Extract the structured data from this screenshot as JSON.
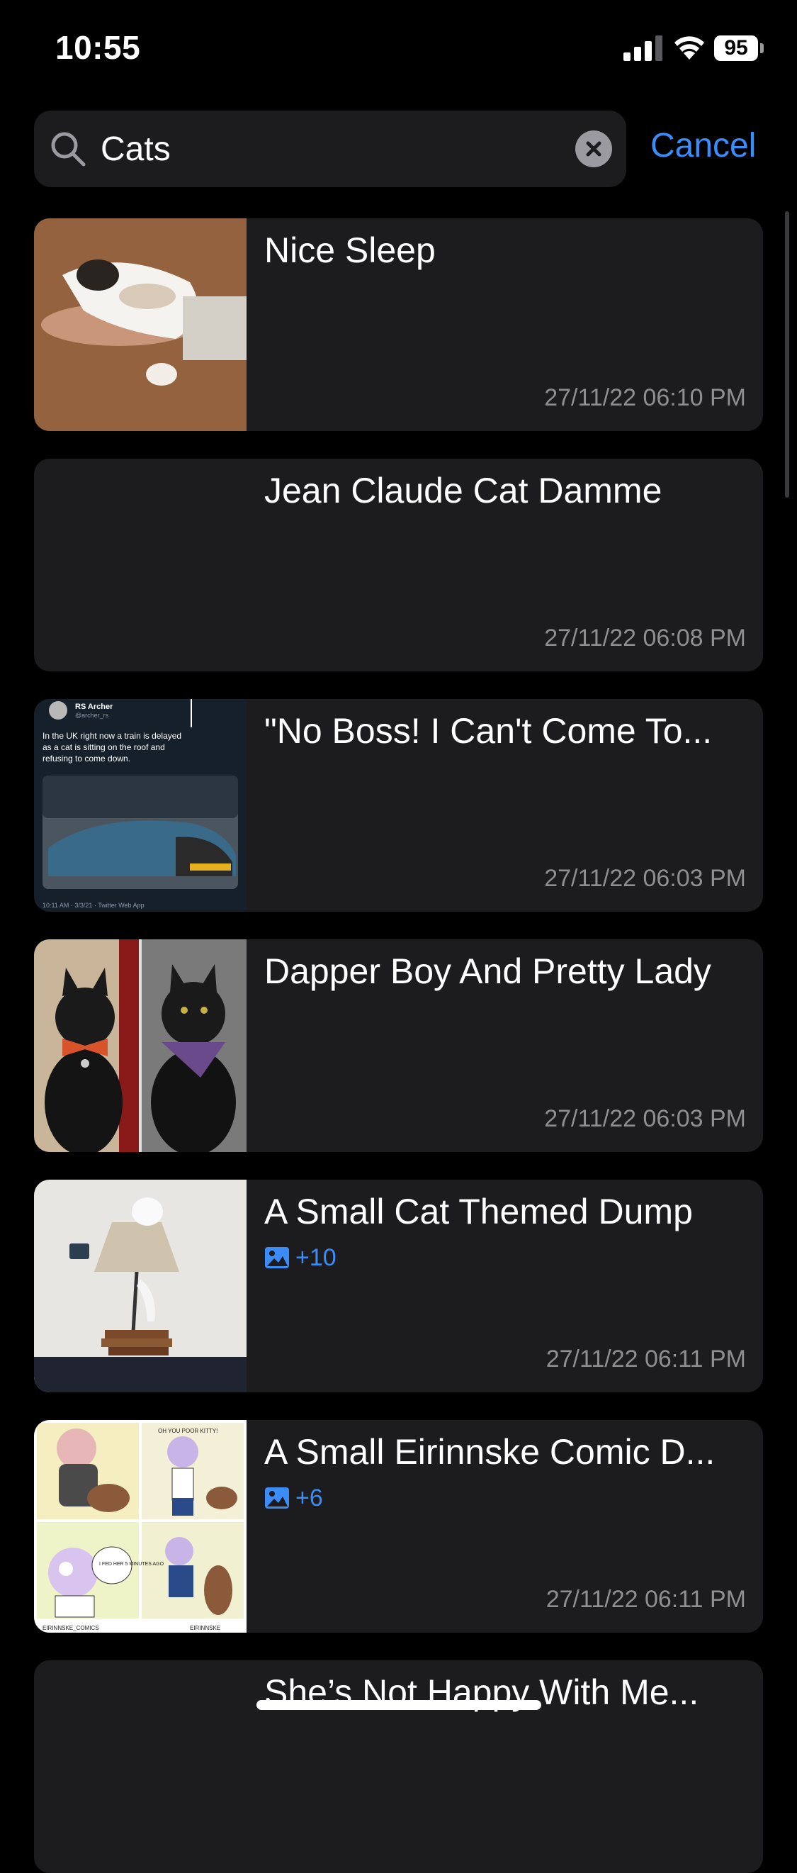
{
  "status_bar": {
    "time": "10:55",
    "battery": "95"
  },
  "search": {
    "value": "Cats",
    "cancel_label": "Cancel"
  },
  "results": [
    {
      "title": "Nice Sleep",
      "date": "27/11/22 06:10 PM",
      "image_count": ""
    },
    {
      "title": "Jean Claude Cat Damme",
      "date": "27/11/22 06:08 PM",
      "image_count": ""
    },
    {
      "title": "\"No Boss! I Can't Come To...",
      "date": "27/11/22 06:03 PM",
      "image_count": "",
      "thumb_text": {
        "name": "RS Archer",
        "handle": "@archer_rs",
        "body1": "In the UK right now a train is delayed",
        "body2": "as a cat is sitting on the roof and",
        "body3": "refusing to come down.",
        "footer": "10:11 AM · 3/3/21 · Twitter Web App"
      }
    },
    {
      "title": "Dapper Boy And Pretty Lady",
      "date": "27/11/22 06:03 PM",
      "image_count": ""
    },
    {
      "title": "A Small Cat Themed Dump",
      "date": "27/11/22 06:11 PM",
      "image_count": "+10"
    },
    {
      "title": "A Small Eirinnske Comic D...",
      "date": "27/11/22 06:11 PM",
      "image_count": "+6",
      "thumb_text": {
        "top": "OH YOU POOR KITTY!",
        "bottom_left": "EIRINNSKE_COMICS",
        "bottom_right": "EIRINNSKE",
        "speech": "I FED HER 5 MINUTES AGO"
      }
    },
    {
      "title": "She’s Not Happy With Me...",
      "date": "",
      "image_count": ""
    }
  ],
  "colors": {
    "accent": "#3b8cf6",
    "card": "#1c1c1e",
    "date": "#8e8e93"
  }
}
